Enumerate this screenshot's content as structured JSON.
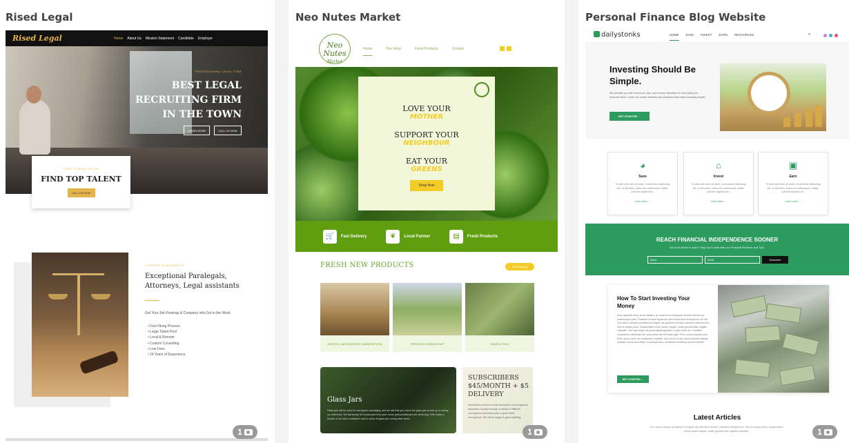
{
  "cards": [
    {
      "title": "Rised Legal",
      "nav": {
        "logo": "Rised Legal",
        "items": [
          "Home",
          "About Us",
          "Mission Statement",
          "Candidate",
          "Employer"
        ]
      },
      "hero": {
        "eyebrow": "PROFESSIONAL LEGAL FIRM",
        "headline": "BEST LEGAL RECRUITING FIRM IN THE TOWN",
        "btn_learn": "LEARN MORE",
        "btn_call": "CALL US NOW"
      },
      "consult": {
        "eyebrow": "FREE CONSULTATION",
        "title": "FIND TOP TALENT",
        "button": "CALL US NOW"
      },
      "section": {
        "eyebrow": "FOREVER PLACEMENTS",
        "title": "Exceptional Paralegals, Attorneys, Legal assistants",
        "text": "Get Your Job Postings & Company Info Out to the Word.",
        "list": [
          "Fast Hiring Process",
          "Large Talent Pool",
          "Local & Remote",
          "Custom Consulting",
          "Low Fees",
          "24 Years of Experience"
        ]
      },
      "photo_count": "1"
    },
    {
      "title": "Neo Nutes Market",
      "logo_main": "Neo Nutes",
      "logo_sub": "Market",
      "nav": [
        "Home",
        "Our Story",
        "Fresh Products",
        "Contact"
      ],
      "hero_lines": [
        {
          "top": "LOVE YOUR",
          "script": "MOTHER"
        },
        {
          "top": "SUPPORT YOUR",
          "script": "NEIGHBOUR"
        },
        {
          "top": "EAT YOUR",
          "script": "GREENS"
        }
      ],
      "shop_button": "Shop Now",
      "features": [
        "Fast Delivery",
        "Local Farmer",
        "Fresh Products"
      ],
      "fresh_title": "FRESH NEW PRODUCTS",
      "fresh_badge": "All Products",
      "products": [
        "MONTHLY MICROGREEN SUBSCRIPTION",
        "SPROUTED GRAIN SOUP",
        "SAMPLE PACK"
      ],
      "jar": {
        "title": "Glass Jars",
        "text": "Glass jars will be used for microgreen packaging, and we ask that you return the glass jars at pick up or during our deliveries. We will accept all unused jars from your home (presumably jars are obviously). Will create a bundle of our store containers used to drop off glass jars during other times."
      },
      "subscribe": {
        "title": "SUBSCRIBERS $45/MONTH + $5 DELIVERY",
        "text": "Subscribers receive a fresh assortment of microgreens harvested. Contact through a variety of different microgreens and seasonally to grow better microgreens. We will be happy to grow anything."
      },
      "photo_count": "1"
    },
    {
      "title": "Personal Finance Blog Website",
      "logo": "dailystonks",
      "nav": [
        "HOME",
        "SAVE",
        "INVEST",
        "EARN",
        "RESOURCES"
      ],
      "hero": {
        "title": "Investing Should Be Simple.",
        "text": "We provide you with resources, tips, and money education to help build your financial future. Learn the smart methods and practices that make investing simple.",
        "button": "GET STARTED →"
      },
      "features": [
        {
          "icon": "pie-chart-icon",
          "glyph": "◕",
          "title": "Save",
          "text": "To start with color sit amet, consectetur adipiscing elit. Ut elit tellus, luctus nec ullamcorper mattis, pulvinar dapibus leo.",
          "link": "Learn more →"
        },
        {
          "icon": "house-icon",
          "glyph": "⌂",
          "title": "Invest",
          "text": "To start with color sit amet, consectetur adipiscing elit. Ut elit tellus, luctus nec ullamcorper mattis, pulvinar dapibus leo.",
          "link": "Learn more →"
        },
        {
          "icon": "money-bill-icon",
          "glyph": "▣",
          "title": "Earn",
          "text": "To start with color sit amet, consectetur adipiscing elit. Ut elit tellus, luctus nec ullamcorper mattis, pulvinar dapibus leo.",
          "link": "Learn more →"
        }
      ],
      "band": {
        "title": "REACH FINANCIAL INDEPENDENCE SOONER",
        "text": "Not sure where to start? Stay Up-to-date with our Financial Reviews and Tips.",
        "name_placeholder": "Name",
        "email_placeholder": "Email",
        "button": "Subscribe"
      },
      "article": {
        "title": "How To Start Investing Your Money",
        "text": "Duis vulputate turpis ac mi tristique, eu laoreet est consequat. Aenean ultrices est pellentesque justo. Praesent sit amet ligula non dolor fermentum suscipit non vel nisi. Orci varius natoque penatibus et magnis dis parturient montes, nascetur ridiculus mus. Sed ut massa purus. Suspendisse rutrum quam magnis, mollis gravida diam sagittis vulputate. Sed eget augue at purus sagittis gravida. In quis varius dui. Curabitur consectetur sollicitudin dui, quis varius est venenatis eget. Proin varius tristique nunc. Proin auctor dolor nec vestibulum molestie. Sed vel leo id nisi viverra lobortis tristique. Quisque varius risus tellus, in volutpat risus. Vestibulum facilisis justo sed semper.",
        "button": "GET STARTED →"
      },
      "latest_title": "Latest Articles",
      "latest_text": "Orci varius natoque penatibus et magnis dis parturient montes, nascetur ridiculus mus. Sed ut massa purus. Suspendisse rutrum quam magnis, mollis gravida diam sagittis vulputate.",
      "photo_count": "1"
    }
  ],
  "colors": {
    "legal_gold": "#e6b34a",
    "neo_green": "#5f9e0c",
    "neo_yellow": "#f4cc27",
    "finance_green": "#2e9b5e"
  }
}
